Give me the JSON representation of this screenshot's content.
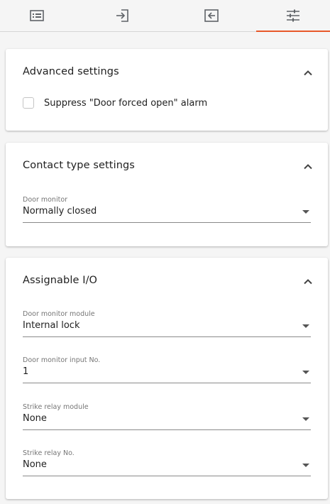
{
  "colors": {
    "accent": "#e8582a",
    "icon": "#5f6368"
  },
  "tabs": [
    {
      "icon": "list-card-icon",
      "active": false
    },
    {
      "icon": "sign-in-icon",
      "active": false
    },
    {
      "icon": "sign-out-icon",
      "active": false
    },
    {
      "icon": "tune-sliders-icon",
      "active": true
    }
  ],
  "advanced": {
    "title": "Advanced settings",
    "suppress_label": "Suppress \"Door forced open\" alarm",
    "suppress_checked": false
  },
  "contact": {
    "title": "Contact type settings",
    "door_monitor_label": "Door monitor",
    "door_monitor_value": "Normally closed"
  },
  "assignable": {
    "title": "Assignable I/O",
    "fields": [
      {
        "label": "Door monitor module",
        "value": "Internal lock"
      },
      {
        "label": "Door monitor input No.",
        "value": "1"
      },
      {
        "label": "Strike relay module",
        "value": "None"
      },
      {
        "label": "Strike relay No.",
        "value": "None"
      }
    ]
  }
}
